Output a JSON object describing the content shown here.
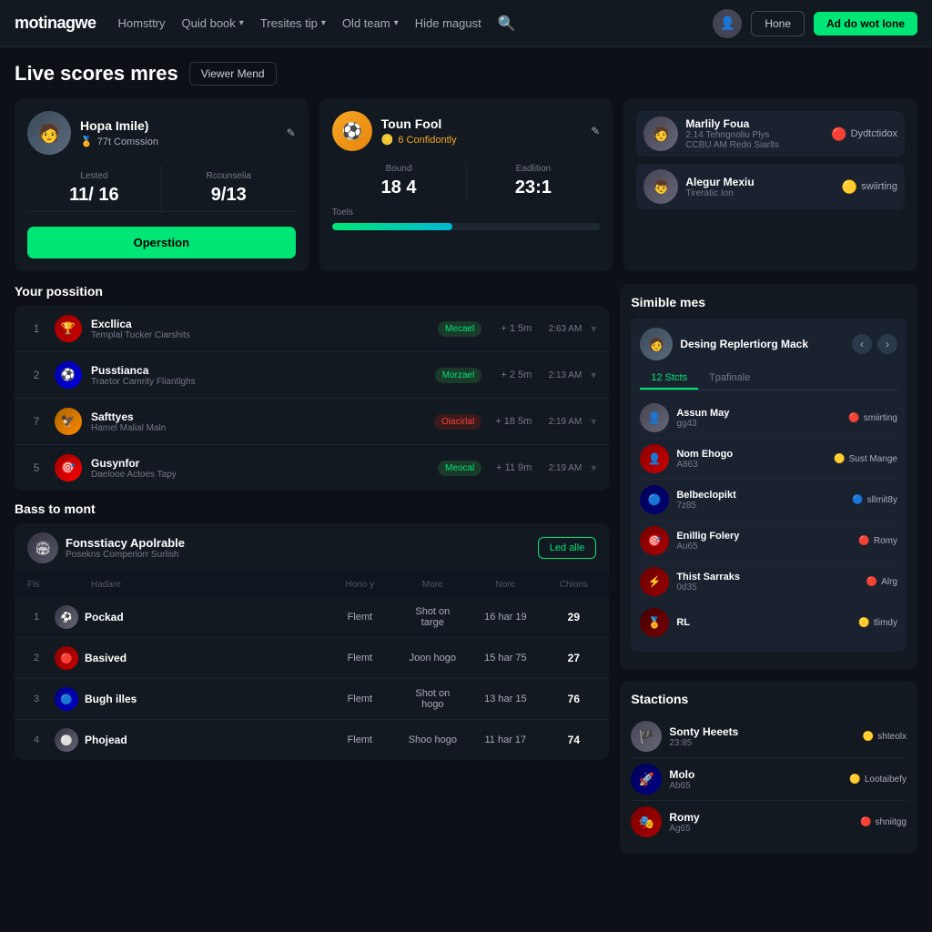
{
  "navbar": {
    "logo": "motinagwe",
    "links": [
      {
        "label": "Homsttry",
        "has_dropdown": false
      },
      {
        "label": "Quid book",
        "has_dropdown": true
      },
      {
        "label": "Tresites tip",
        "has_dropdown": true
      },
      {
        "label": "Old team",
        "has_dropdown": true
      },
      {
        "label": "Hide magust",
        "has_dropdown": false
      }
    ],
    "search_icon": "🔍",
    "btn_outline_label": "Hone",
    "btn_green_label": "Ad do wot Ione"
  },
  "page": {
    "title": "Live scores mres",
    "view_more_btn": "Viewer Mend"
  },
  "card1": {
    "player_name": "Hopa Imile)",
    "player_meta": "77t Comssion",
    "edit_icon": "✎",
    "stat1_label": "Lested",
    "stat1_value": "11/ 16",
    "stat2_label": "Rcounselia",
    "stat2_value": "9/13",
    "btn_label": "Operstion"
  },
  "card2": {
    "team_name": "Toun Fool",
    "team_meta": "6 Confidontly",
    "edit_icon": "✎",
    "stat1_label": "Bound",
    "stat1_value": "18 4",
    "stat2_label": "Eadlition",
    "stat2_value": "23:1",
    "tools_label": "Toels",
    "progress_percent": 45
  },
  "card3": {
    "player1_name": "Marlily Foua",
    "player1_sub1": "2.14 Tehngnoliu Plys",
    "player1_sub2": "CCBU AM Redo Siarlts",
    "player1_badge": "Dydtctidox",
    "player2_name": "Alegur Mexiu",
    "player2_sub": "Tireratic Ion",
    "player2_badge": "swiirting"
  },
  "section_position": {
    "title": "Your possition",
    "rows": [
      {
        "num": "1",
        "logo": "🏆",
        "logo_color": "#c00",
        "name": "Excllica",
        "sub": "Templal Tucker Ciarshits",
        "badge": "Mecael",
        "badge_type": "green",
        "change": "+ 1 5m",
        "time": "2:63 AM"
      },
      {
        "num": "2",
        "logo": "⚽",
        "logo_color": "#e00",
        "name": "Pusstianca",
        "sub": "Traetor Camrity Fliantlghs",
        "badge": "Morzael",
        "badge_type": "green",
        "change": "+ 2 5m",
        "time": "2:13 AM"
      },
      {
        "num": "7",
        "logo": "🦅",
        "logo_color": "#f5a623",
        "name": "Safttyes",
        "sub": "Hamel Malial Maln",
        "badge": "Oiacirlal",
        "badge_type": "red",
        "change": "+ 18 5m",
        "time": "2:19 AM"
      },
      {
        "num": "5",
        "logo": "🎯",
        "logo_color": "#e00",
        "name": "Gusynfor",
        "sub": "Daelooe Actoes Tapy",
        "badge": "Meocal",
        "badge_type": "green",
        "change": "+ 11 9m",
        "time": "2:19 AM"
      }
    ]
  },
  "comparison": {
    "title": "Bass to mont",
    "logo": "🏟",
    "name": "Fonsstiacy Apolrable",
    "sub": "Posekns Comperiorr Surlish",
    "load_all_btn": "Led alle",
    "headers": {
      "num": "Fls",
      "name": "Hadare",
      "home": "Hono y",
      "more": "More",
      "note": "Nore",
      "chion": "Chions"
    },
    "rows": [
      {
        "num": "1",
        "logo": "⚽",
        "logo_color": "#556",
        "name": "Pockad",
        "home": "Flemt",
        "more": "Shot on targe",
        "note": "16 har 19",
        "chion": "29"
      },
      {
        "num": "2",
        "logo": "🔴",
        "logo_color": "#a00",
        "name": "Basived",
        "home": "Flemt",
        "more": "Joon hogo",
        "note": "15 har 75",
        "chion": "27"
      },
      {
        "num": "3",
        "logo": "🔵",
        "logo_color": "#00a",
        "name": "Bugh illes",
        "home": "Flemt",
        "more": "Shot on hogo",
        "note": "13 har 15",
        "chion": "76"
      },
      {
        "num": "4",
        "logo": "⚪",
        "logo_color": "#556",
        "name": "Phojead",
        "home": "Flemt",
        "more": "Shoo hogo",
        "note": "11 har 17",
        "chion": "74"
      }
    ]
  },
  "similar": {
    "title": "Simible mes",
    "inner_name": "Desing Replertiorg Mack",
    "tabs": [
      "12 Stcts",
      "Tpafinale"
    ],
    "active_tab": 0,
    "players": [
      {
        "name": "Assun May",
        "sub": "gg43",
        "badge": "smiirting",
        "badge_icon": "🔴"
      },
      {
        "name": "Nom Ehogo",
        "sub": "A863",
        "badge": "Sust Mange",
        "badge_icon": "🟡"
      },
      {
        "name": "Belbeclopikt",
        "sub": "7z85",
        "badge": "sllmit8y",
        "badge_icon": "🔵"
      },
      {
        "name": "Enillig Folery",
        "sub": "Au65",
        "badge": "Romy",
        "badge_icon": "🔴"
      },
      {
        "name": "Thist Sarraks",
        "sub": "0d35",
        "badge": "Alrg",
        "badge_icon": "🔴"
      },
      {
        "name": "RL",
        "sub": "",
        "badge": "tlimdy",
        "badge_icon": "🟡"
      }
    ]
  },
  "stations": {
    "title": "Stactions",
    "players": [
      {
        "name": "Sonty Heeets",
        "sub": "23:85",
        "badge": "shteolx",
        "badge_icon": "🟡"
      },
      {
        "name": "Molo",
        "sub": "Ab65",
        "badge": "Lootaibefy",
        "badge_icon": "🟡"
      },
      {
        "name": "Romy",
        "sub": "Ag65",
        "badge": "shniitgg",
        "badge_icon": "🔴"
      }
    ]
  }
}
